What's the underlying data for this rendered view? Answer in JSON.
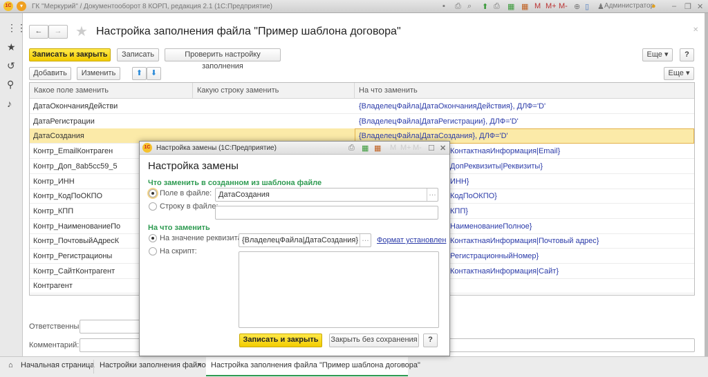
{
  "app": {
    "title": "ГК \"Меркурий\" / Документооборот 8 КОРП, редакция 2.1  (1С:Предприятие)",
    "user": "Администратор",
    "memory_buttons": [
      "M",
      "M+",
      "M-"
    ],
    "logo": "1С"
  },
  "form": {
    "title": "Настройка заполнения файла \"Пример шаблона договора\"",
    "toolbar": {
      "save_close": "Записать и закрыть",
      "save": "Записать",
      "check": "Проверить настройку заполнения",
      "more": "Еще",
      "help": "?"
    },
    "table_toolbar": {
      "add": "Добавить",
      "edit": "Изменить",
      "more": "Еще"
    },
    "table": {
      "columns": [
        "Какое поле заменить",
        "Какую строку заменить",
        "На что заменить"
      ],
      "selected_row": 2,
      "rows": [
        {
          "field": "ДатаОкончанияДействи",
          "string": "",
          "value": "{ВладелецФайла|ДатаОкончанияДействия}, ДЛФ='D'"
        },
        {
          "field": "ДатаРегистрации",
          "string": "",
          "value": "{ВладелецФайла|ДатаРегистрации}, ДЛФ='D'"
        },
        {
          "field": "ДатаСоздания",
          "string": "",
          "value": "{ВладелецФайла|ДатаСоздания}, ДЛФ='D'"
        },
        {
          "field": "Контр_EmailКонтраген",
          "string": "",
          "value": "КонтактнаяИнформация|Email}"
        },
        {
          "field": "Контр_Доп_8ab5cc59_5",
          "string": "",
          "value": "ДопРеквизиты|Реквизиты}"
        },
        {
          "field": "Контр_ИНН",
          "string": "",
          "value": "ИНН}"
        },
        {
          "field": "Контр_КодПоОКПО",
          "string": "",
          "value": "КодПоОКПО}"
        },
        {
          "field": "Контр_КПП",
          "string": "",
          "value": "КПП}"
        },
        {
          "field": "Контр_НаименованиеПо",
          "string": "",
          "value": "НаименованиеПолное}"
        },
        {
          "field": "Контр_ПочтовыйАдресК",
          "string": "",
          "value": "КонтактнаяИнформация|Почтовый адрес}"
        },
        {
          "field": "Контр_Регистрационы",
          "string": "",
          "value": "РегистрационныйНомер}"
        },
        {
          "field": "Контр_СайтКонтрагент",
          "string": "",
          "value": "КонтактнаяИнформация|Сайт}"
        },
        {
          "field": "Контрагент",
          "string": "",
          "value": ""
        }
      ]
    },
    "responsible_label": "Ответственный:",
    "comment_label": "Комментарий:"
  },
  "dialog": {
    "window_title": "Настройка замены  (1С:Предприятие)",
    "title": "Настройка замены",
    "section1": "Что заменить в созданном из шаблона файле",
    "radio_field": "Поле в файле:",
    "field_value": "ДатаСоздания",
    "radio_string": "Строку в файле:",
    "string_value": "",
    "section2": "На что заменить",
    "radio_attr": "На значение реквизита:",
    "attr_value": "{ВладелецФайла|ДатаСоздания}",
    "format_link": "Формат установлен",
    "radio_script": "На скрипт:",
    "script_value": "",
    "save_close": "Записать и закрыть",
    "close_nosave": "Закрыть без сохранения",
    "help": "?"
  },
  "tabs": [
    {
      "label": "Начальная страница"
    },
    {
      "label": "Настройки заполнения файлов"
    },
    {
      "label": "Настройка заполнения файла \"Пример шаблона договора\"",
      "active": true
    }
  ],
  "colors": {
    "accent_yellow": "#f2cc00",
    "selected_row": "#fbeaa8",
    "link": "#2a3aa8",
    "section": "#2f9b52"
  }
}
